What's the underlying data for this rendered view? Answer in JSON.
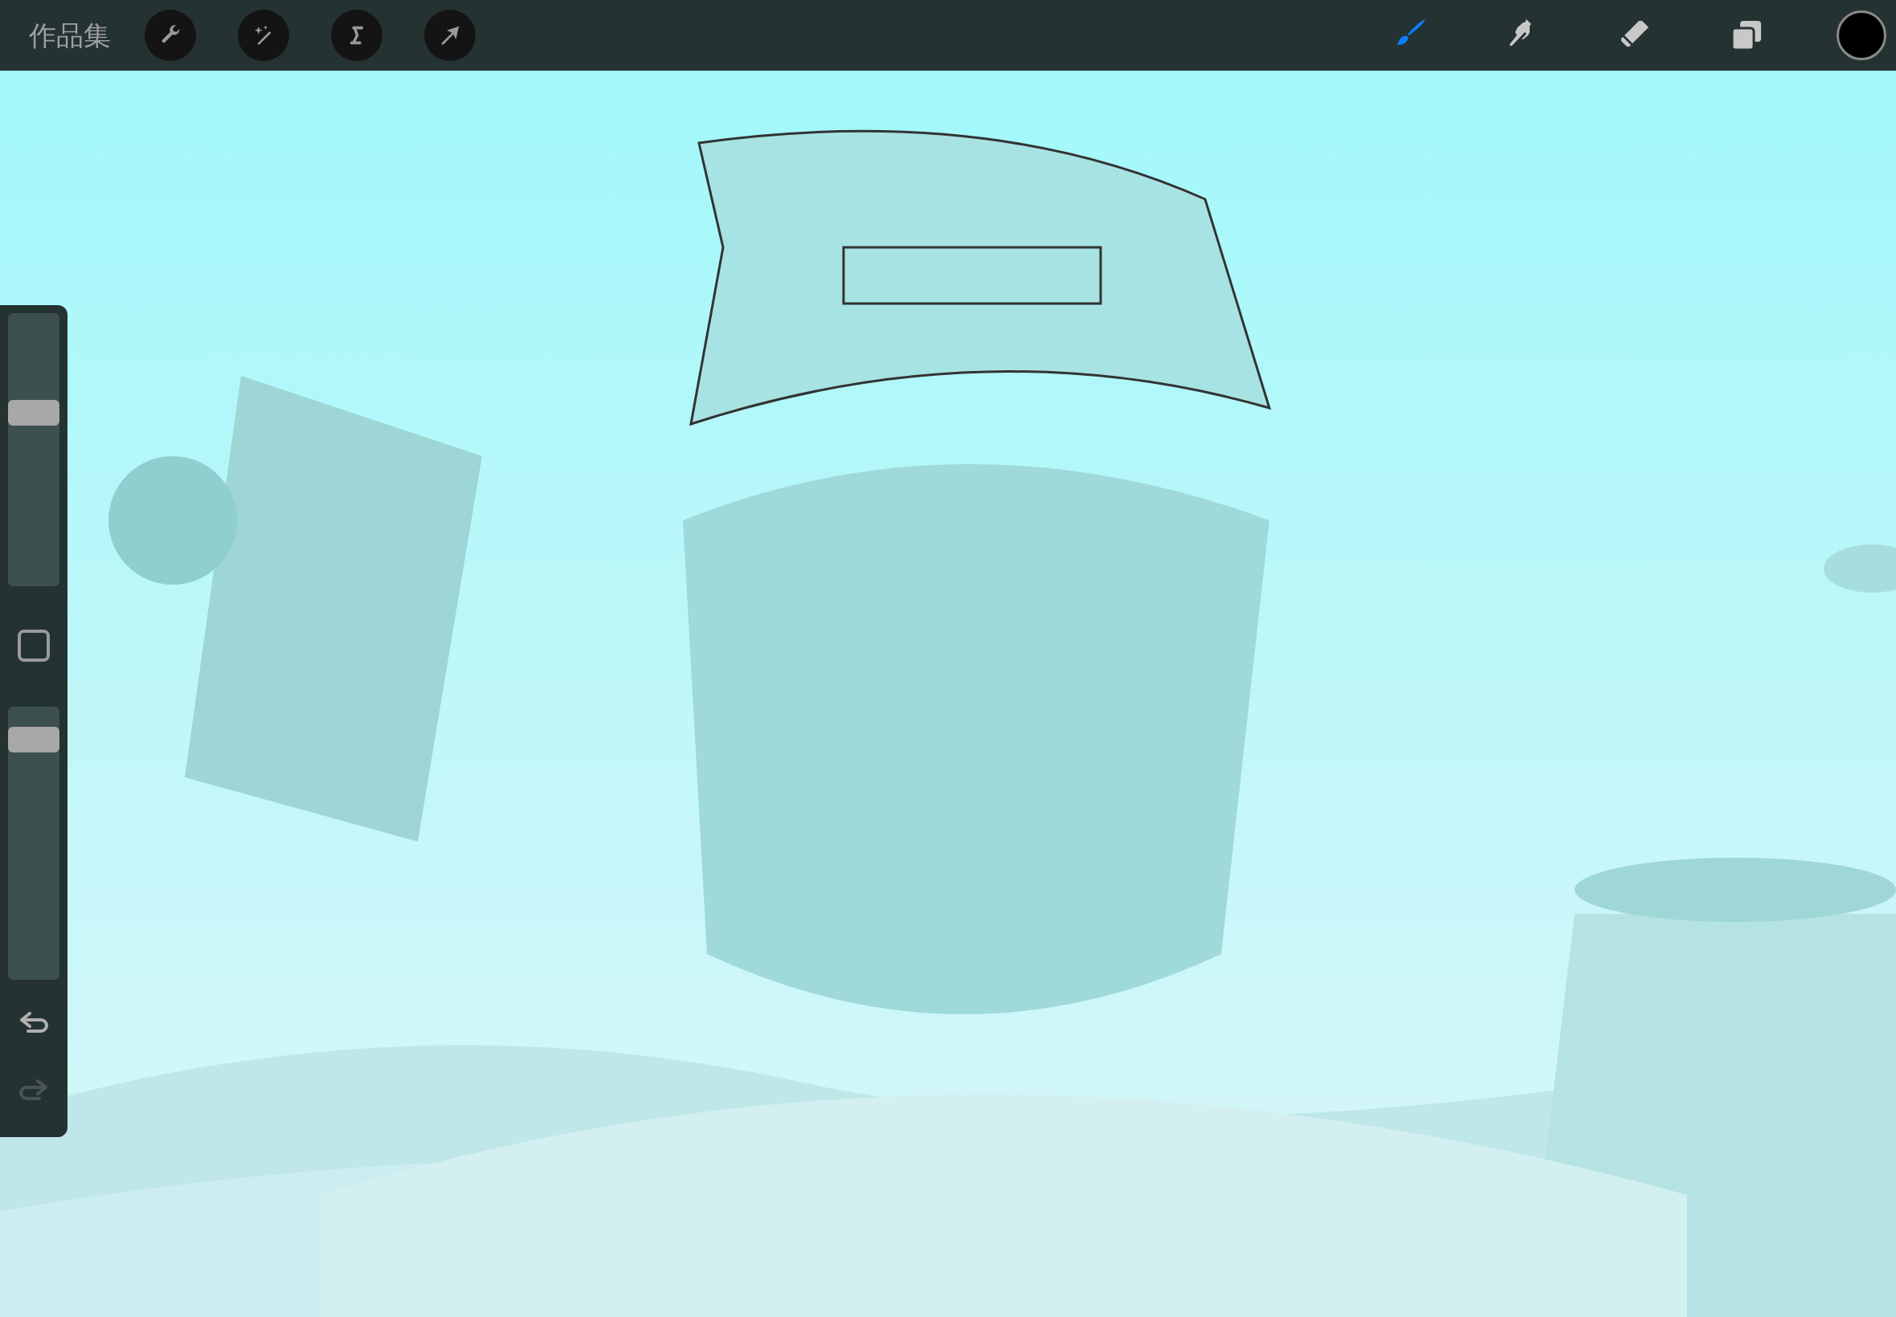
{
  "top_bar": {
    "gallery_label": "作品集",
    "actions": [
      {
        "kind": "wrench"
      },
      {
        "kind": "magic"
      },
      {
        "kind": "selection"
      },
      {
        "kind": "transform"
      }
    ],
    "tools": [
      {
        "kind": "brush",
        "selected": true
      },
      {
        "kind": "smudge",
        "selected": false
      },
      {
        "kind": "eraser",
        "selected": false
      },
      {
        "kind": "layers",
        "selected": false
      }
    ]
  },
  "sidebar": {
    "brush_size": {
      "level": 0.65
    },
    "opacity": {
      "level": 0.92
    },
    "undo": {
      "disabled": false
    },
    "redo": {
      "disabled": true
    }
  }
}
